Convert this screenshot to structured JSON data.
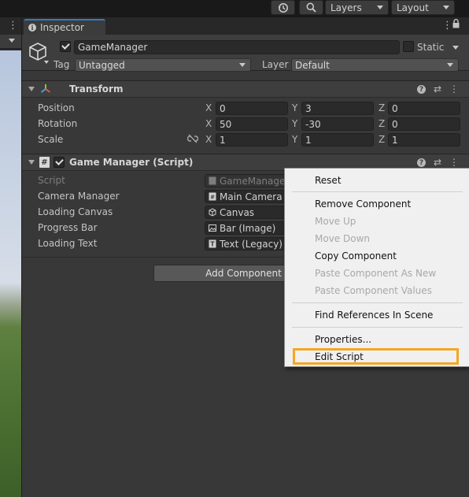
{
  "toolbar": {
    "layers_label": "Layers",
    "layout_label": "Layout"
  },
  "inspector": {
    "tab_label": "Inspector",
    "object_name": "GameManager",
    "static_label": "Static",
    "tag_label": "Tag",
    "tag_value": "Untagged",
    "layer_label": "Layer",
    "layer_value": "Default"
  },
  "transform": {
    "title": "Transform",
    "position_label": "Position",
    "rotation_label": "Rotation",
    "scale_label": "Scale",
    "axis_x": "X",
    "axis_y": "Y",
    "axis_z": "Z",
    "position": {
      "x": "0",
      "y": "3",
      "z": "0"
    },
    "rotation": {
      "x": "50",
      "y": "-30",
      "z": "0"
    },
    "scale": {
      "x": "1",
      "y": "1",
      "z": "1"
    }
  },
  "game_manager": {
    "title": "Game Manager (Script)",
    "fields": [
      {
        "label": "Script",
        "value": "GameManager"
      },
      {
        "label": "Camera Manager",
        "value": "Main Camera ("
      },
      {
        "label": "Loading Canvas",
        "value": "Canvas"
      },
      {
        "label": "Progress Bar",
        "value": "Bar (Image)"
      },
      {
        "label": "Loading Text",
        "value": "Text (Legacy) ("
      }
    ]
  },
  "add_component_label": "Add Component",
  "context_menu": {
    "items": [
      {
        "label": "Reset",
        "enabled": true
      },
      {
        "label": "Remove Component",
        "enabled": true
      },
      {
        "label": "Move Up",
        "enabled": false
      },
      {
        "label": "Move Down",
        "enabled": false
      },
      {
        "label": "Copy Component",
        "enabled": true
      },
      {
        "label": "Paste Component As New",
        "enabled": false
      },
      {
        "label": "Paste Component Values",
        "enabled": false
      },
      {
        "label": "Find References In Scene",
        "enabled": true
      },
      {
        "label": "Properties...",
        "enabled": true
      },
      {
        "label": "Edit Script",
        "enabled": true,
        "highlighted": true
      }
    ]
  },
  "colors": {
    "highlight": "#f5a623",
    "panel": "#383838",
    "menu": "#f0f0f0"
  }
}
